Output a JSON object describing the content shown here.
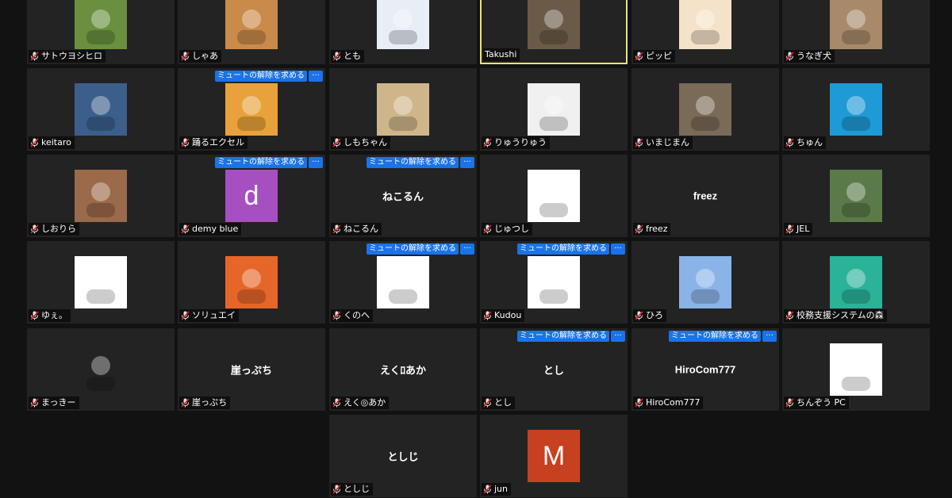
{
  "gallery": {
    "unmute_label": "ミュートの解除を求める",
    "more_label": "···",
    "participants": [
      {
        "name": "サトウヨシヒロ",
        "avatar_color": "#6a8f3f",
        "avatar_icon": "book-cover-avatar",
        "muted": true
      },
      {
        "name": "しゃあ",
        "avatar_color": "#c98a4a",
        "avatar_icon": "anime-character-avatar",
        "muted": true
      },
      {
        "name": "とも",
        "avatar_color": "#e8eef5",
        "avatar_icon": "windows-logo-avatar",
        "muted": true
      },
      {
        "name": "Takushi",
        "avatar_color": "#6b5a48",
        "avatar_icon": "tower-photo-avatar",
        "muted": false,
        "speaking": true
      },
      {
        "name": "ピッピ",
        "avatar_color": "#f4e3c8",
        "avatar_icon": "cartoon-face-avatar",
        "muted": true
      },
      {
        "name": "うなぎ犬",
        "avatar_color": "#a88a6a",
        "avatar_icon": "animal-photo-avatar",
        "muted": true
      },
      {
        "name": "keitaro",
        "avatar_color": "#3b5f8a",
        "avatar_icon": "landscape-photo-avatar",
        "muted": true
      },
      {
        "name": "踊るエクセル",
        "avatar_color": "#e9a23b",
        "avatar_icon": "dancing-character-avatar",
        "muted": true,
        "unmute_request": true
      },
      {
        "name": "しもちゃん",
        "avatar_color": "#cfb68a",
        "avatar_icon": "drink-photo-avatar",
        "muted": true
      },
      {
        "name": "りゅうりゅう",
        "avatar_color": "#f0f0f0",
        "avatar_icon": "i-love-vba-avatar",
        "muted": true
      },
      {
        "name": "いまじまん",
        "avatar_color": "#7a6a58",
        "avatar_icon": "coffee-cups-avatar",
        "muted": true
      },
      {
        "name": "ちゅん",
        "avatar_color": "#1e9ad6",
        "avatar_icon": "bird-excel-avatar",
        "muted": true
      },
      {
        "name": "しおりら",
        "avatar_color": "#9a6a4a",
        "avatar_icon": "dog-photo-avatar",
        "muted": true
      },
      {
        "name": "demy blue",
        "avatar_color": "#a64fc0",
        "avatar_letter": "d",
        "muted": true,
        "unmute_request": true
      },
      {
        "name": "ねこるん",
        "big_name": "ねこるん",
        "muted": true,
        "unmute_request": true
      },
      {
        "name": "じゅつし",
        "avatar_color": "#ffffff",
        "avatar_icon": "glasses-man-avatar",
        "muted": true
      },
      {
        "name": "freez",
        "big_name": "freez",
        "muted": true
      },
      {
        "name": "JEL",
        "avatar_color": "#5a7a4a",
        "avatar_icon": "shop-photo-avatar",
        "muted": true
      },
      {
        "name": "ゆぇ。",
        "avatar_color": "#ffffff",
        "avatar_icon": "pikachu-avatar",
        "muted": true
      },
      {
        "name": "ソリュエイ",
        "avatar_color": "#e6662a",
        "avatar_icon": "anime-crying-avatar",
        "muted": true
      },
      {
        "name": "くのへ",
        "avatar_color": "#ffffff",
        "avatar_icon": "magpie-avatar",
        "muted": true,
        "unmute_request": true
      },
      {
        "name": "Kudou",
        "avatar_color": "#ffffff",
        "avatar_icon": "whale-avatar",
        "muted": true,
        "unmute_request": true
      },
      {
        "name": "ひろ",
        "avatar_color": "#8ab4e8",
        "avatar_icon": "building-sky-avatar",
        "muted": true
      },
      {
        "name": "校務支援システムの森",
        "avatar_color": "#2bb39a",
        "avatar_icon": "leaf-logo-avatar",
        "muted": true
      },
      {
        "name": "まっきー",
        "avatar_color": "#232323",
        "avatar_icon": "pixel-character-avatar",
        "muted": true
      },
      {
        "name": "崖っぷち",
        "big_name": "崖っぷち",
        "muted": true
      },
      {
        "name": "えく◎あか",
        "big_name": "えくﾛあか",
        "muted": true
      },
      {
        "name": "とし",
        "big_name": "とし",
        "muted": true,
        "unmute_request": true
      },
      {
        "name": "HiroCom777",
        "big_name": "HiroCom777",
        "muted": true,
        "unmute_request": true
      },
      {
        "name": "ちんぞう PC",
        "avatar_color": "#ffffff",
        "avatar_icon": "pink-face-avatar",
        "muted": true
      },
      {
        "name": "としじ",
        "big_name": "としじ",
        "muted": true
      },
      {
        "name": "jun",
        "avatar_color": "#c7401f",
        "avatar_letter": "M",
        "muted": true
      }
    ]
  }
}
